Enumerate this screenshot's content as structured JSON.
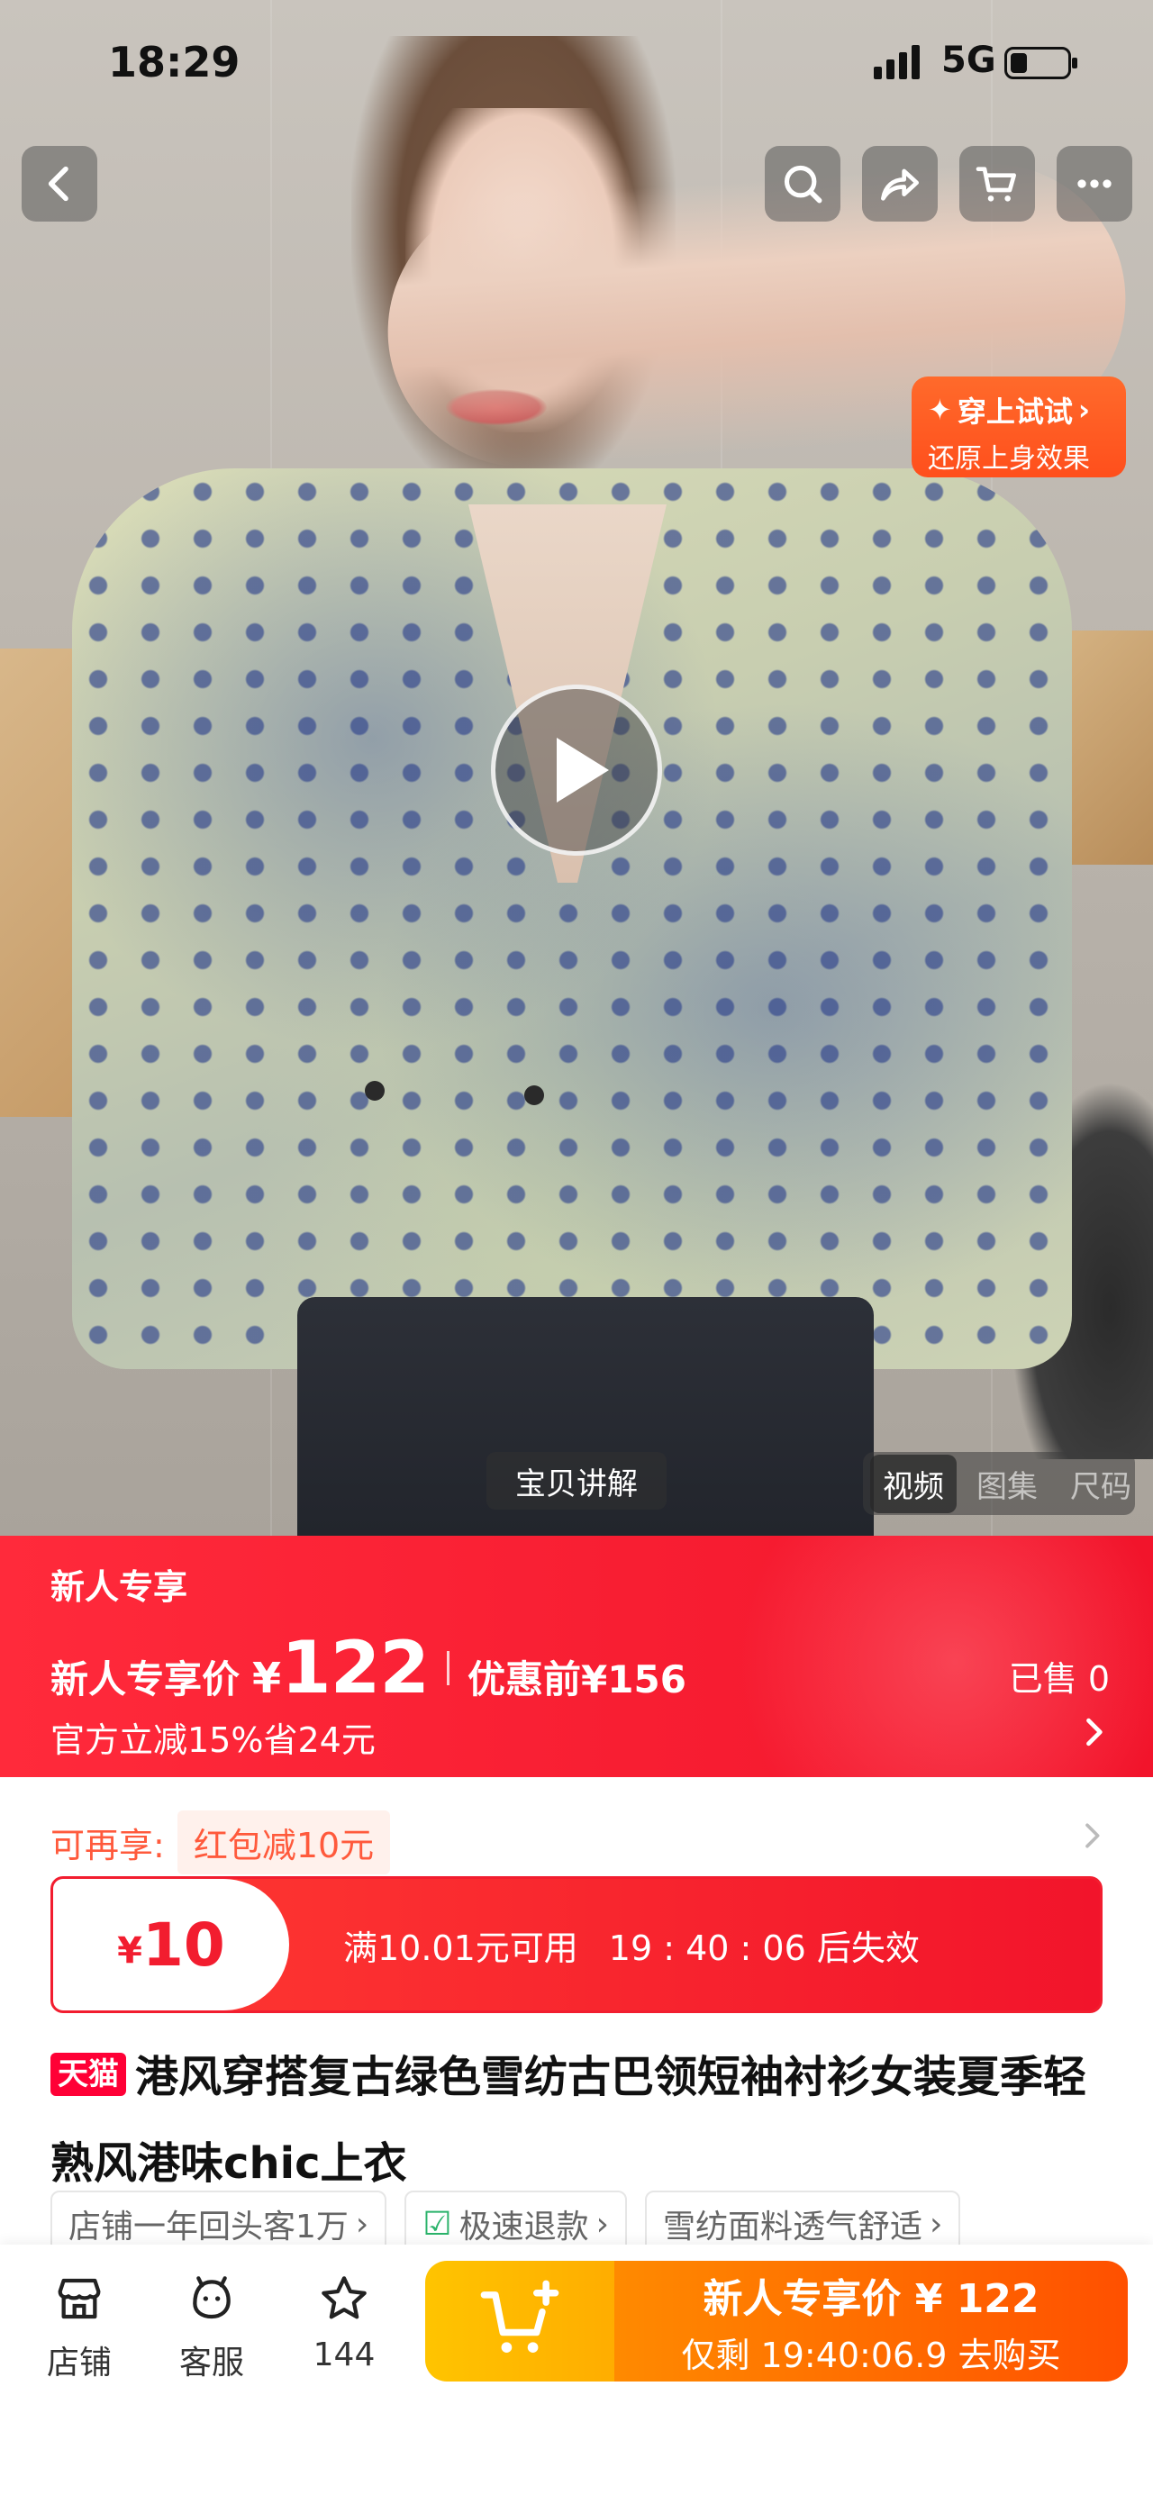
{
  "status_bar": {
    "time": "18:29",
    "network": "5G"
  },
  "product_media": {
    "explain_label": "宝贝讲解",
    "tabs": [
      {
        "label": "视频",
        "active": true
      },
      {
        "label": "图集",
        "active": false
      },
      {
        "label": "尺码",
        "active": false
      }
    ],
    "tryon": {
      "title": "穿上试试",
      "subtitle": "还原上身效果"
    }
  },
  "promo": {
    "tag": "新人专享",
    "price_label": "新人专享价",
    "currency": "¥",
    "price": "122",
    "original_price": "优惠前¥156",
    "sold": "已售 0",
    "discount_text": "官方立减15%省24元"
  },
  "coupon_hint": {
    "label": "可再享:",
    "value": "红包减10元"
  },
  "coupon": {
    "currency": "¥",
    "amount": "10",
    "condition": "满10.01元可用",
    "countdown": "19 : 40 : 06 后失效"
  },
  "product": {
    "badge": "天猫",
    "title": "港风穿搭复古绿色雪纺古巴领短袖衬衫女装夏季轻熟风港味chic上衣"
  },
  "feature_chips": [
    "店铺一年回头客1万",
    "极速退款",
    "雪纺面料透气舒适"
  ],
  "bottom_bar": {
    "store_label": "店铺",
    "service_label": "客服",
    "favorites_count": "144",
    "buy_line1": "新人专享价 ¥ 122",
    "buy_line2": "仅剩 19:40:06.9 去购买"
  },
  "colors": {
    "promo_red": "#f2142b",
    "buy_orange": "#ff5000",
    "cart_yellow": "#ffc400"
  }
}
